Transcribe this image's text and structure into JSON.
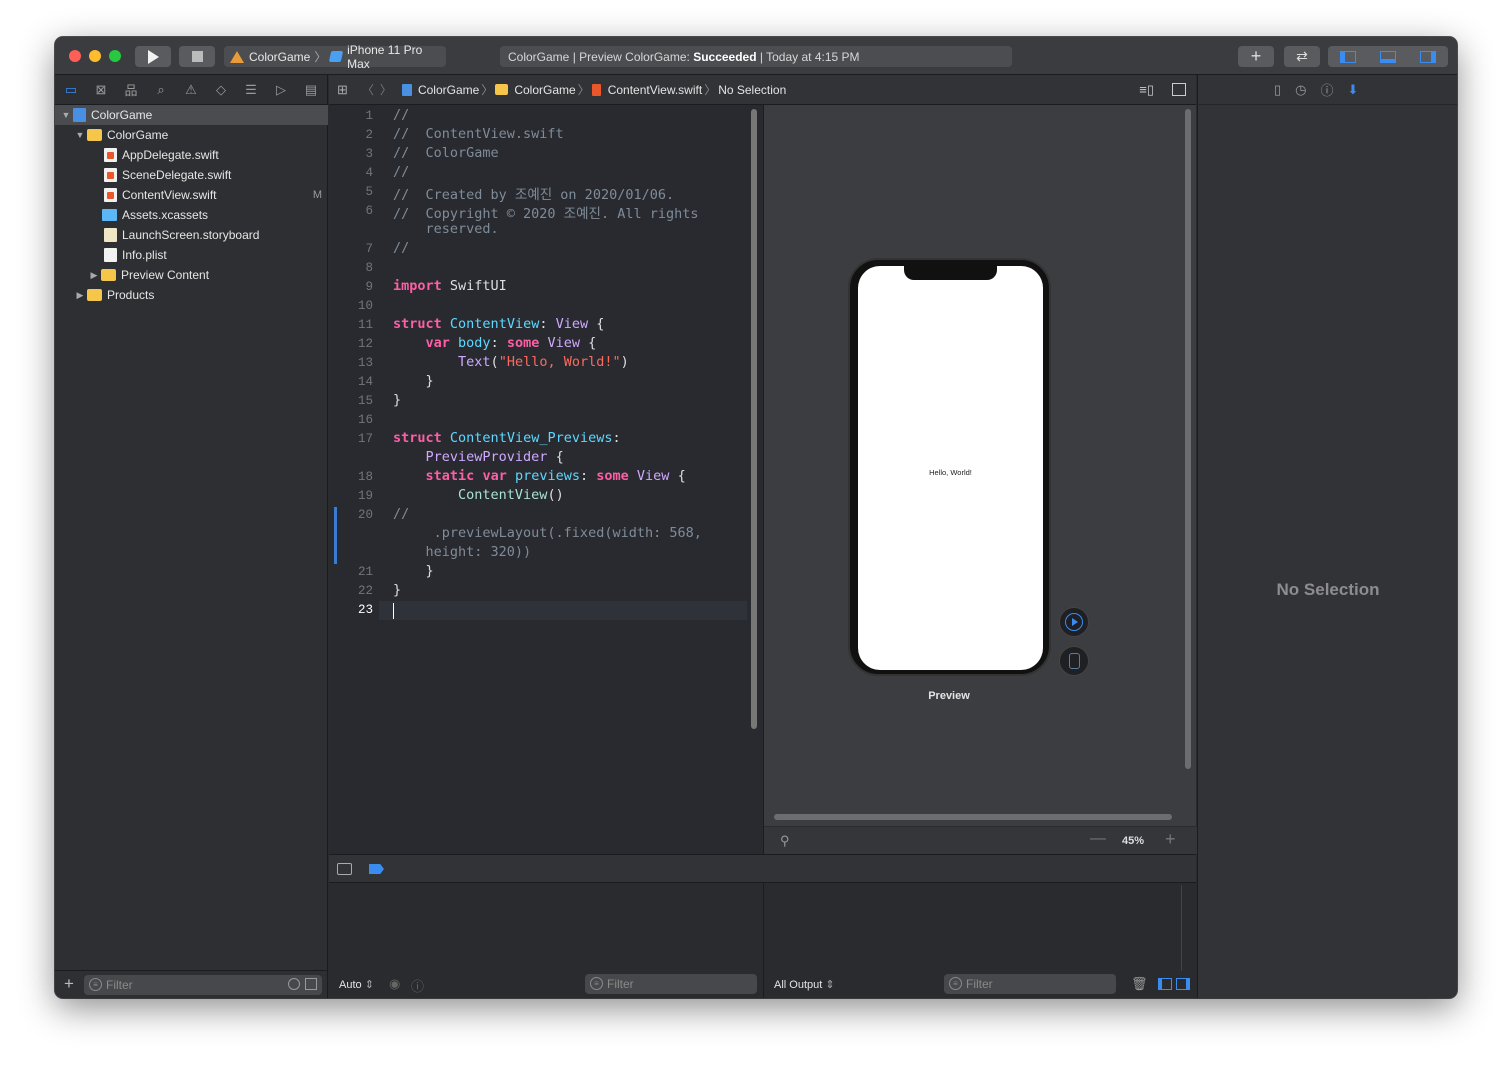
{
  "toolbar": {
    "scheme_target": "ColorGame",
    "scheme_device": "iPhone 11 Pro Max",
    "status_prefix": "ColorGame | Preview ColorGame: ",
    "status_result": "Succeeded",
    "status_time": " | Today at 4:15 PM"
  },
  "navigator": {
    "items": [
      {
        "label": "ColorGame",
        "icon": "project-icon"
      },
      {
        "label": "ColorGame",
        "icon": "folder-icon"
      },
      {
        "label": "AppDelegate.swift",
        "icon": "swift-file-icon"
      },
      {
        "label": "SceneDelegate.swift",
        "icon": "swift-file-icon"
      },
      {
        "label": "ContentView.swift",
        "icon": "swift-file-icon",
        "badge": "M"
      },
      {
        "label": "Assets.xcassets",
        "icon": "asset-catalog-icon"
      },
      {
        "label": "LaunchScreen.storyboard",
        "icon": "storyboard-icon"
      },
      {
        "label": "Info.plist",
        "icon": "plist-icon"
      },
      {
        "label": "Preview Content",
        "icon": "folder-icon"
      },
      {
        "label": "Products",
        "icon": "folder-icon"
      }
    ],
    "filter_placeholder": "Filter"
  },
  "jumpbar": {
    "crumbs": [
      "ColorGame",
      "ColorGame",
      "ContentView.swift",
      "No Selection"
    ]
  },
  "editor": {
    "line_numbers": [
      "1",
      "2",
      "3",
      "4",
      "5",
      "6",
      "7",
      "8",
      "9",
      "10",
      "11",
      "12",
      "13",
      "14",
      "15",
      "16",
      "17",
      "18",
      "19",
      "20",
      "21",
      "22",
      "23"
    ]
  },
  "canvas": {
    "preview_text": "Hello, World!",
    "preview_label": "Preview",
    "zoom": "45%"
  },
  "inspector": {
    "empty_text": "No Selection"
  },
  "debug": {
    "variables_mode": "Auto",
    "output_mode": "All Output",
    "filter_placeholder": "Filter"
  }
}
